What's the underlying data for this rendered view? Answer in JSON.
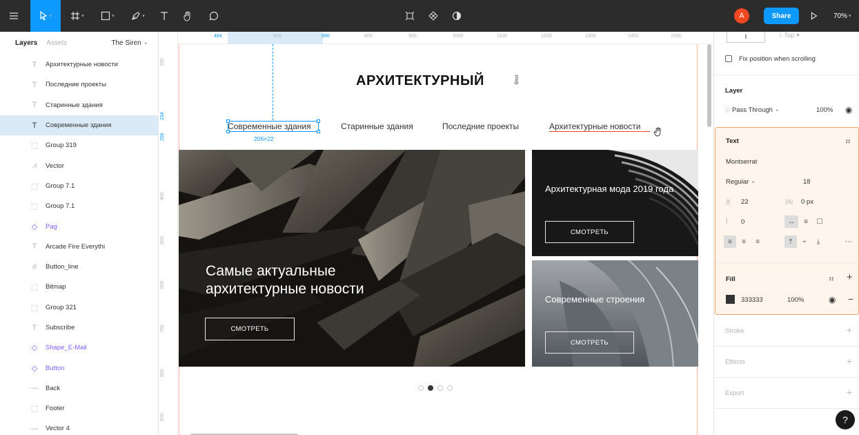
{
  "toolbar": {
    "zoom": "70%",
    "share_label": "Share",
    "avatar_initial": "A",
    "tools": [
      "menu-icon",
      "move-icon",
      "frame-icon",
      "shape-icon",
      "pen-icon",
      "text-icon",
      "hand-icon",
      "comment-icon"
    ],
    "center_tools": [
      "component-icon",
      "assets-icon",
      "contrast-icon"
    ]
  },
  "layers_panel": {
    "tab_layers": "Layers",
    "tab_assets": "Assets",
    "page_name": "The Siren",
    "items": [
      {
        "label": "Архитектурные новости",
        "icon": "text-icon"
      },
      {
        "label": "Последние проекты",
        "icon": "text-icon"
      },
      {
        "label": "Старинные здания",
        "icon": "text-icon"
      },
      {
        "label": "Современные здания",
        "icon": "text-icon",
        "selected": true
      },
      {
        "label": "Group 319",
        "icon": "group-icon"
      },
      {
        "label": "Vector",
        "icon": "vector-icon"
      },
      {
        "label": "Group 7.1",
        "icon": "group-icon"
      },
      {
        "label": "Group 7.1",
        "icon": "group-icon"
      },
      {
        "label": "Pag",
        "icon": "component-icon",
        "component": true
      },
      {
        "label": "Arcade Fire Everythi",
        "icon": "text-icon"
      },
      {
        "label": "Button_line",
        "icon": "frame-icon"
      },
      {
        "label": "Bitmap",
        "icon": "image-icon"
      },
      {
        "label": "Group 321",
        "icon": "group-icon"
      },
      {
        "label": "Subscribe",
        "icon": "text-icon"
      },
      {
        "label": "Shape_E-Mail",
        "icon": "component-icon",
        "component": true
      },
      {
        "label": "Button",
        "icon": "component-icon",
        "component": true
      },
      {
        "label": "Back",
        "icon": "line-icon"
      },
      {
        "label": "Footer",
        "icon": "group-icon"
      },
      {
        "label": "Vector 4",
        "icon": "line-icon"
      }
    ]
  },
  "rulers": {
    "horizontal": [
      "484",
      "600",
      "690",
      "800",
      "900",
      "1000",
      "1100",
      "1200",
      "1300",
      "1400",
      "1500"
    ],
    "vertical": [
      "100",
      "234",
      "256",
      "400",
      "500",
      "600",
      "700",
      "800",
      "900"
    ]
  },
  "canvas": {
    "logo": "АРХИТЕКТУРНЫЙ",
    "logo_sub": "блог",
    "nav": [
      "Современные здания",
      "Старинные здания",
      "Последние проекты",
      "Архитектурные новости"
    ],
    "selection_size": "206×22",
    "hero_title": "Самые актуальные архитектурные новости",
    "hero_button": "СМОТРЕТЬ",
    "card1_title": "Архитектурная мода 2019 года",
    "card1_button": "СМОТРЕТЬ",
    "card2_title": "Современные строения",
    "card2_button": "СМОТРЕТЬ",
    "pager": {
      "count": 4,
      "active": 2
    }
  },
  "properties": {
    "constraint_h": "I",
    "constraint_v": "Top",
    "fix_position": "Fix position when scrolling",
    "layer_title": "Layer",
    "blend_mode": "Pass Through",
    "layer_opacity": "100%",
    "text_title": "Text",
    "font_family": "Montserrat",
    "font_weight": "Regular",
    "font_size": "18",
    "line_height": "22",
    "letter_spacing": "0 px",
    "paragraph_spacing": "0",
    "fill_title": "Fill",
    "fill_hex": "333333",
    "fill_opacity": "100%",
    "stroke_title": "Stroke",
    "effects_title": "Effects",
    "export_title": "Export",
    "help": "?"
  },
  "colors": {
    "accent": "#0d99ff",
    "fill": "#333333",
    "text_section_border": "#f5a25d",
    "avatar": "#f24822"
  }
}
